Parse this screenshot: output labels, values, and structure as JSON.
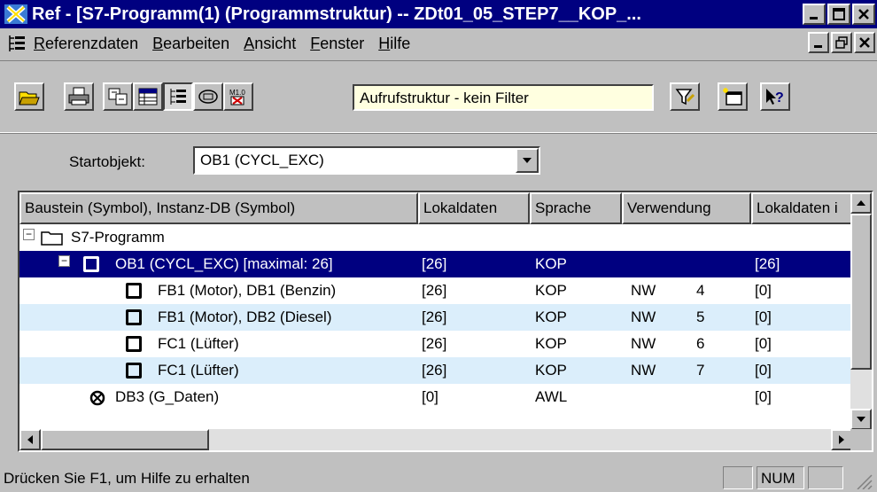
{
  "window": {
    "title": "Ref - [S7-Programm(1) (Programmstruktur) -- ZDt01_05_STEP7__KOP_..."
  },
  "menu": {
    "items": [
      {
        "u": "R",
        "rest": "eferenzdaten"
      },
      {
        "u": "B",
        "rest": "earbeiten"
      },
      {
        "u": "A",
        "rest": "nsicht"
      },
      {
        "u": "F",
        "rest": "enster"
      },
      {
        "u": "H",
        "rest": "ilfe"
      }
    ]
  },
  "toolbar": {
    "filter_text": "Aufrufstruktur - kein Filter"
  },
  "start": {
    "label": "Startobjekt:",
    "value": "OB1 (CYCL_EXC)"
  },
  "table": {
    "columns": [
      "Baustein (Symbol), Instanz-DB (Symbol)",
      "Lokaldaten",
      "Sprache",
      "Verwendung",
      "Lokaldaten i"
    ],
    "rows": [
      {
        "name": "S7-Programm",
        "lokal": "",
        "sprache": "",
        "nw": "",
        "num": "",
        "lokal2": ""
      },
      {
        "name": "OB1 (CYCL_EXC) [maximal: 26]",
        "lokal": "[26]",
        "sprache": "KOP",
        "nw": "",
        "num": "",
        "lokal2": "[26]"
      },
      {
        "name": "FB1 (Motor), DB1 (Benzin)",
        "lokal": "[26]",
        "sprache": "KOP",
        "nw": "NW",
        "num": "4",
        "lokal2": "[0]"
      },
      {
        "name": "FB1 (Motor), DB2 (Diesel)",
        "lokal": "[26]",
        "sprache": "KOP",
        "nw": "NW",
        "num": "5",
        "lokal2": "[0]"
      },
      {
        "name": "FC1 (Lüfter)",
        "lokal": "[26]",
        "sprache": "KOP",
        "nw": "NW",
        "num": "6",
        "lokal2": "[0]"
      },
      {
        "name": "FC1 (Lüfter)",
        "lokal": "[26]",
        "sprache": "KOP",
        "nw": "NW",
        "num": "7",
        "lokal2": "[0]"
      },
      {
        "name": "DB3 (G_Daten)",
        "lokal": "[0]",
        "sprache": "AWL",
        "nw": "",
        "num": "",
        "lokal2": "[0]"
      }
    ]
  },
  "status": {
    "text": "Drücken Sie F1, um Hilfe zu erhalten",
    "num": "NUM"
  },
  "colors": {
    "titlebar": "#000080",
    "selection": "#000080",
    "alt_row": "#dbeefb",
    "filter_bg": "#ffffe0"
  }
}
